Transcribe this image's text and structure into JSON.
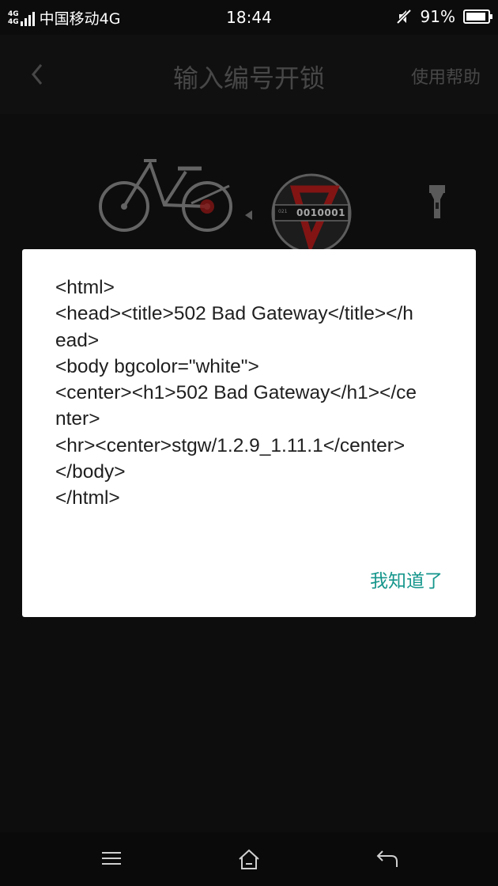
{
  "status_bar": {
    "network_tag_1": "4G",
    "network_tag_2": "4G",
    "carrier": "中国移动4G",
    "time": "18:44",
    "battery": "91%",
    "icons": [
      "signal-icon",
      "mute-icon",
      "battery-icon"
    ]
  },
  "header": {
    "title": "输入编号开锁",
    "help": "使用帮助",
    "icons": [
      "back-icon"
    ]
  },
  "illustration": {
    "plate_number": "0010001",
    "icons": [
      "bike-icon",
      "arrow-left-icon",
      "flashlight-icon"
    ],
    "accent_color": "#c8201f"
  },
  "dialog": {
    "message": "<html>\n<head><title>502 Bad Gateway</title></head>\n<body bgcolor=\"white\">\n<center><h1>502 Bad Gateway</h1></center>\n<hr><center>stgw/1.2.9_1.11.1</center>\n</body>\n</html>",
    "confirm": "我知道了",
    "confirm_color": "#15968c"
  },
  "nav_bar": {
    "icons": [
      "menu-icon",
      "home-icon",
      "back-nav-icon"
    ]
  }
}
